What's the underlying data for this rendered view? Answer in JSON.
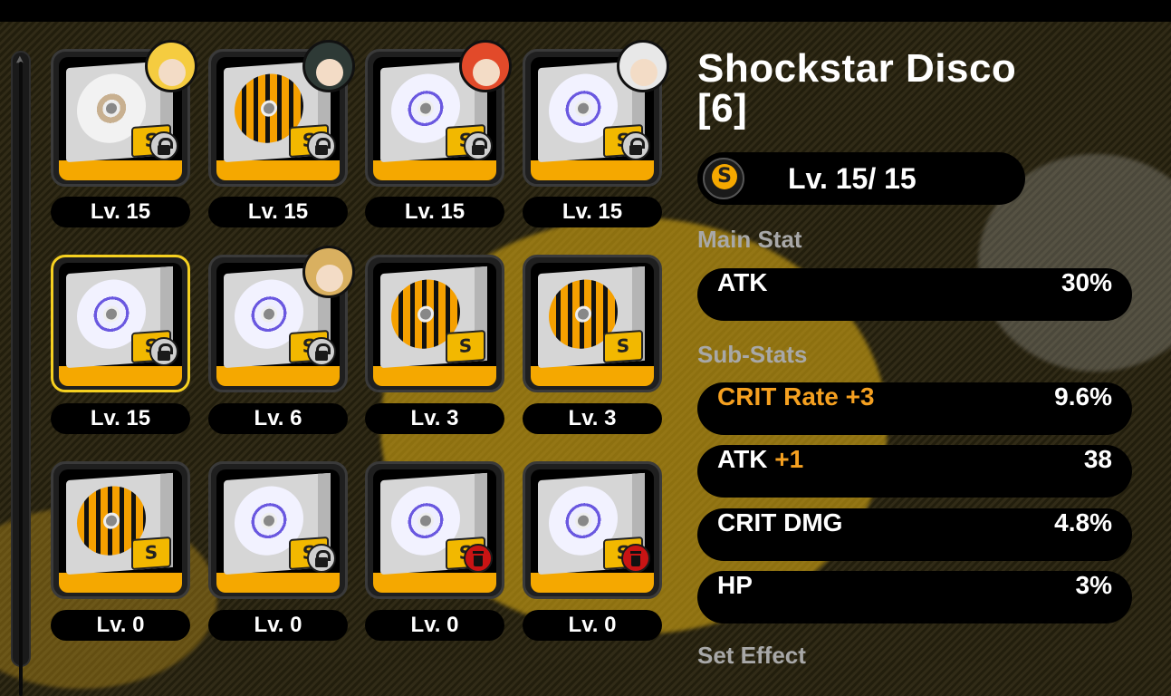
{
  "header": {
    "title": "Shockstar Disco\n[6]"
  },
  "level": {
    "text": "Lv. 15/ 15",
    "icon": "rarity-s-icon"
  },
  "main_stat": {
    "label": "Main Stat",
    "name": "ATK",
    "value": "30%"
  },
  "sub_stats": {
    "label": "Sub-Stats",
    "items": [
      {
        "name": "CRIT Rate",
        "roll": "+3",
        "value": "9.6%",
        "highlight": true
      },
      {
        "name": "ATK",
        "roll": "+1",
        "value": "38",
        "highlight": false
      },
      {
        "name": "CRIT DMG",
        "roll": "",
        "value": "4.8%",
        "highlight": false
      },
      {
        "name": "HP",
        "roll": "",
        "value": "3%",
        "highlight": false
      }
    ]
  },
  "set_effect": {
    "label": "Set Effect"
  },
  "colors": {
    "accent_orange": "#f5a020",
    "card_bar": "#f5a800",
    "selected_border": "#f5d020",
    "trash_red": "#c81414"
  },
  "discs": [
    {
      "level": "Lv. 15",
      "pattern": "star-white",
      "badge": "lock",
      "avatar": "yellow-hair",
      "selected": false
    },
    {
      "level": "Lv. 15",
      "pattern": "tiger",
      "badge": "lock",
      "avatar": "dark-hair-eyepatch",
      "selected": false
    },
    {
      "level": "Lv. 15",
      "pattern": "star-blue",
      "badge": "lock",
      "avatar": "red-hair",
      "selected": false
    },
    {
      "level": "Lv. 15",
      "pattern": "star-blue",
      "badge": "lock",
      "avatar": "white-hair",
      "selected": false
    },
    {
      "level": "Lv. 15",
      "pattern": "star-blue",
      "badge": "lock",
      "avatar": "",
      "selected": true
    },
    {
      "level": "Lv. 6",
      "pattern": "star-blue",
      "badge": "lock",
      "avatar": "blonde-mask",
      "selected": false
    },
    {
      "level": "Lv. 3",
      "pattern": "tiger",
      "badge": "",
      "avatar": "",
      "selected": false
    },
    {
      "level": "Lv. 3",
      "pattern": "tiger",
      "badge": "",
      "avatar": "",
      "selected": false
    },
    {
      "level": "Lv. 0",
      "pattern": "tiger",
      "badge": "",
      "avatar": "",
      "selected": false
    },
    {
      "level": "Lv. 0",
      "pattern": "star-blue",
      "badge": "lock",
      "avatar": "",
      "selected": false
    },
    {
      "level": "Lv. 0",
      "pattern": "star-blue",
      "badge": "trash",
      "avatar": "",
      "selected": false
    },
    {
      "level": "Lv. 0",
      "pattern": "star-blue",
      "badge": "trash",
      "avatar": "",
      "selected": false
    }
  ]
}
